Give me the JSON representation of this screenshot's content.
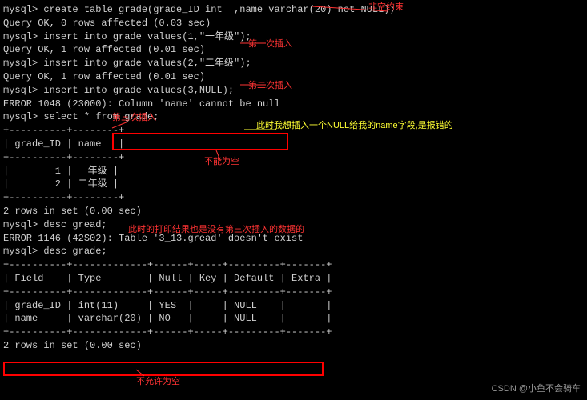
{
  "lines": {
    "l01": "mysql> create table grade(grade_ID int  ,name varchar(20) not NULL);",
    "l02": "Query OK, 0 rows affected (0.03 sec)",
    "l03": "",
    "l04": "mysql> insert into grade values(1,\"一年级\");",
    "l05": "Query OK, 1 row affected (0.01 sec)",
    "l06": "",
    "l07": "mysql> insert into grade values(2,\"二年级\");",
    "l08": "Query OK, 1 row affected (0.01 sec)",
    "l09": "",
    "l10": "mysql> insert into grade values(3,NULL);",
    "l11": "ERROR 1048 (23000): Column 'name' cannot be null",
    "l12": "mysql> select * from grade;",
    "l13": "+----------+--------+",
    "l14": "| grade_ID | name   |",
    "l15": "+----------+--------+",
    "l16": "|        1 | 一年级 |",
    "l17": "|        2 | 二年级 |",
    "l18": "+----------+--------+",
    "l19": "2 rows in set (0.00 sec)",
    "l20": "",
    "l21": "mysql> desc gread;",
    "l22": "ERROR 1146 (42S02): Table '3_13.gread' doesn't exist",
    "l23": "mysql> desc grade;",
    "l24": "+----------+-------------+------+-----+---------+-------+",
    "l25": "| Field    | Type        | Null | Key | Default | Extra |",
    "l26": "+----------+-------------+------+-----+---------+-------+",
    "l27": "| grade_ID | int(11)     | YES  |     | NULL    |       |",
    "l28": "| name     | varchar(20) | NO   |     | NULL    |       |",
    "l29": "+----------+-------------+------+-----+---------+-------+",
    "l30": "2 rows in set (0.00 sec)"
  },
  "annotations": {
    "a1": "非空约束",
    "a2": "第一次插入",
    "a3": "第二次插入",
    "a4": "第三次插入",
    "a5": "此时我想插入一个NULL给我的name字段,是报错的",
    "a6": "不能为空",
    "a7": "此时的打印结果也是没有第三次插入的数据的",
    "a8": "不允许为空"
  },
  "chart_data": [
    {
      "type": "table",
      "title": "grade",
      "columns": [
        "grade_ID",
        "name"
      ],
      "rows": [
        [
          1,
          "一年级"
        ],
        [
          2,
          "二年级"
        ]
      ]
    },
    {
      "type": "table",
      "title": "desc grade",
      "columns": [
        "Field",
        "Type",
        "Null",
        "Key",
        "Default",
        "Extra"
      ],
      "rows": [
        [
          "grade_ID",
          "int(11)",
          "YES",
          "",
          "NULL",
          ""
        ],
        [
          "name",
          "varchar(20)",
          "NO",
          "",
          "NULL",
          ""
        ]
      ]
    }
  ],
  "watermark": "CSDN @小鱼不会骑车"
}
